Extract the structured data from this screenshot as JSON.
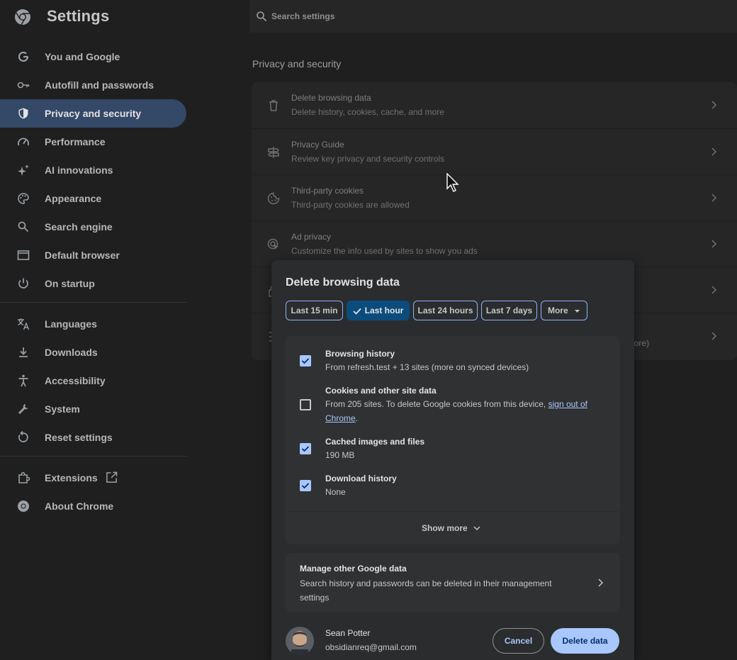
{
  "header": {
    "app_title": "Settings",
    "search_placeholder": "Search settings"
  },
  "sidebar": {
    "items": [
      {
        "label": "You and Google",
        "icon": "google-g-icon"
      },
      {
        "label": "Autofill and passwords",
        "icon": "key-icon"
      },
      {
        "label": "Privacy and security",
        "icon": "shield-icon",
        "active": true
      },
      {
        "label": "Performance",
        "icon": "speedometer-icon"
      },
      {
        "label": "AI innovations",
        "icon": "sparkle-icon"
      },
      {
        "label": "Appearance",
        "icon": "palette-icon"
      },
      {
        "label": "Search engine",
        "icon": "search-icon"
      },
      {
        "label": "Default browser",
        "icon": "browser-window-icon"
      },
      {
        "label": "On startup",
        "icon": "power-icon"
      },
      {
        "label": "Languages",
        "icon": "translate-icon"
      },
      {
        "label": "Downloads",
        "icon": "download-icon"
      },
      {
        "label": "Accessibility",
        "icon": "accessibility-icon"
      },
      {
        "label": "System",
        "icon": "wrench-icon"
      },
      {
        "label": "Reset settings",
        "icon": "reset-icon"
      },
      {
        "label": "Extensions",
        "icon": "puzzle-icon"
      },
      {
        "label": "About Chrome",
        "icon": "chrome-icon"
      }
    ]
  },
  "main": {
    "section_title": "Privacy and security",
    "rows": [
      {
        "title": "Delete browsing data",
        "subtitle": "Delete history, cookies, cache, and more",
        "icon": "trash-icon"
      },
      {
        "title": "Privacy Guide",
        "subtitle": "Review key privacy and security controls",
        "icon": "signpost-icon"
      },
      {
        "title": "Third-party cookies",
        "subtitle": "Third-party cookies are allowed",
        "icon": "cookie-icon"
      },
      {
        "title": "Ad privacy",
        "subtitle": "Customize the info used by sites to show you ads",
        "icon": "ad-target-icon"
      },
      {
        "title": "",
        "subtitle": "",
        "icon": "lock-icon"
      },
      {
        "title": "",
        "subtitle": "nore)",
        "icon": "site-settings-icon"
      }
    ]
  },
  "dialog": {
    "title": "Delete browsing data",
    "time_ranges": [
      "Last 15 min",
      "Last hour",
      "Last 24 hours",
      "Last 7 days",
      "More"
    ],
    "selected_range": "Last hour",
    "options": [
      {
        "title": "Browsing history",
        "subtitle": "From refresh.test + 13 sites (more on synced devices)",
        "checked": true
      },
      {
        "title": "Cookies and other site data",
        "subtitle": "From 205 sites. To delete Google cookies from this device,",
        "link": "sign out of Chrome",
        "suffix": ".",
        "checked": false
      },
      {
        "title": "Cached images and files",
        "subtitle": "190 MB",
        "checked": true
      },
      {
        "title": "Download history",
        "subtitle": "None",
        "checked": true
      }
    ],
    "show_more": "Show more",
    "manage": {
      "title": "Manage other Google data",
      "subtitle": "Search history and passwords can be deleted in their management settings"
    },
    "account": {
      "name": "Sean Potter",
      "email": "obsidianreq@gmail.com"
    },
    "cancel_label": "Cancel",
    "delete_label": "Delete data"
  },
  "colors": {
    "background": "#1f1f1f",
    "active_nav": "#344867",
    "accent": "#a8c7fa",
    "dialog": "#2b2c2e"
  }
}
